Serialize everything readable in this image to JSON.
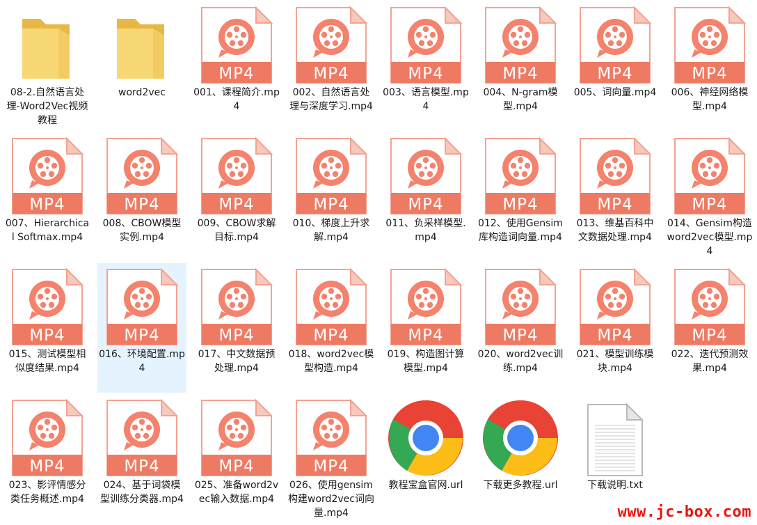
{
  "window": {
    "watermark": "www.jc-box.com"
  },
  "colors": {
    "mp4_body": "#f4826c",
    "mp4_band": "#ee7a63",
    "mp4_fold": "#f7c8bc",
    "folder": "#f8d775",
    "folder_dark": "#e8b845",
    "selection": "#e5f3ff",
    "watermark": "#e8150f"
  },
  "items": [
    {
      "type": "folder",
      "label": "08-2.自然语言处理-Word2Vec视频教程"
    },
    {
      "type": "folder",
      "label": "word2vec"
    },
    {
      "type": "mp4",
      "badge": "MP4",
      "label": "001、课程简介.mp4"
    },
    {
      "type": "mp4",
      "badge": "MP4",
      "label": "002、自然语言处理与深度学习.mp4"
    },
    {
      "type": "mp4",
      "badge": "MP4",
      "label": "003、语言模型.mp4"
    },
    {
      "type": "mp4",
      "badge": "MP4",
      "label": "004、N-gram模型.mp4"
    },
    {
      "type": "mp4",
      "badge": "MP4",
      "label": "005、词向量.mp4"
    },
    {
      "type": "mp4",
      "badge": "MP4",
      "label": "006、神经网络模型.mp4"
    },
    {
      "type": "mp4",
      "badge": "MP4",
      "label": "007、Hierarchical Softmax.mp4"
    },
    {
      "type": "mp4",
      "badge": "MP4",
      "label": "008、CBOW模型实例.mp4"
    },
    {
      "type": "mp4",
      "badge": "MP4",
      "label": "009、CBOW求解目标.mp4"
    },
    {
      "type": "mp4",
      "badge": "MP4",
      "label": "010、梯度上升求解.mp4"
    },
    {
      "type": "mp4",
      "badge": "MP4",
      "label": "011、负采样模型.mp4"
    },
    {
      "type": "mp4",
      "badge": "MP4",
      "label": "012、使用Gensim库构造词向量.mp4"
    },
    {
      "type": "mp4",
      "badge": "MP4",
      "label": "013、维基百科中文数据处理.mp4"
    },
    {
      "type": "mp4",
      "badge": "MP4",
      "label": "014、Gensim构造word2vec模型.mp4"
    },
    {
      "type": "mp4",
      "badge": "MP4",
      "label": "015、测试模型相似度结果.mp4"
    },
    {
      "type": "mp4",
      "badge": "MP4",
      "label": "016、环境配置.mp4",
      "selected": true
    },
    {
      "type": "mp4",
      "badge": "MP4",
      "label": "017、中文数据预处理.mp4"
    },
    {
      "type": "mp4",
      "badge": "MP4",
      "label": "018、word2vec模型构造.mp4"
    },
    {
      "type": "mp4",
      "badge": "MP4",
      "label": "019、构造图计算模型.mp4"
    },
    {
      "type": "mp4",
      "badge": "MP4",
      "label": "020、word2vec训练.mp4"
    },
    {
      "type": "mp4",
      "badge": "MP4",
      "label": "021、模型训练模块.mp4"
    },
    {
      "type": "mp4",
      "badge": "MP4",
      "label": "022、迭代预测效果.mp4"
    },
    {
      "type": "mp4",
      "badge": "MP4",
      "label": "023、影评情感分类任务概述.mp4"
    },
    {
      "type": "mp4",
      "badge": "MP4",
      "label": "024、基于词袋模型训练分类器.mp4"
    },
    {
      "type": "mp4",
      "badge": "MP4",
      "label": "025、准备word2vec输入数据.mp4"
    },
    {
      "type": "mp4",
      "badge": "MP4",
      "label": "026、使用gensim构建word2vec词向量.mp4"
    },
    {
      "type": "chrome",
      "label": "教程宝盒官网.url"
    },
    {
      "type": "chrome",
      "label": "下载更多教程.url"
    },
    {
      "type": "txt",
      "label": "下载说明.txt"
    }
  ]
}
